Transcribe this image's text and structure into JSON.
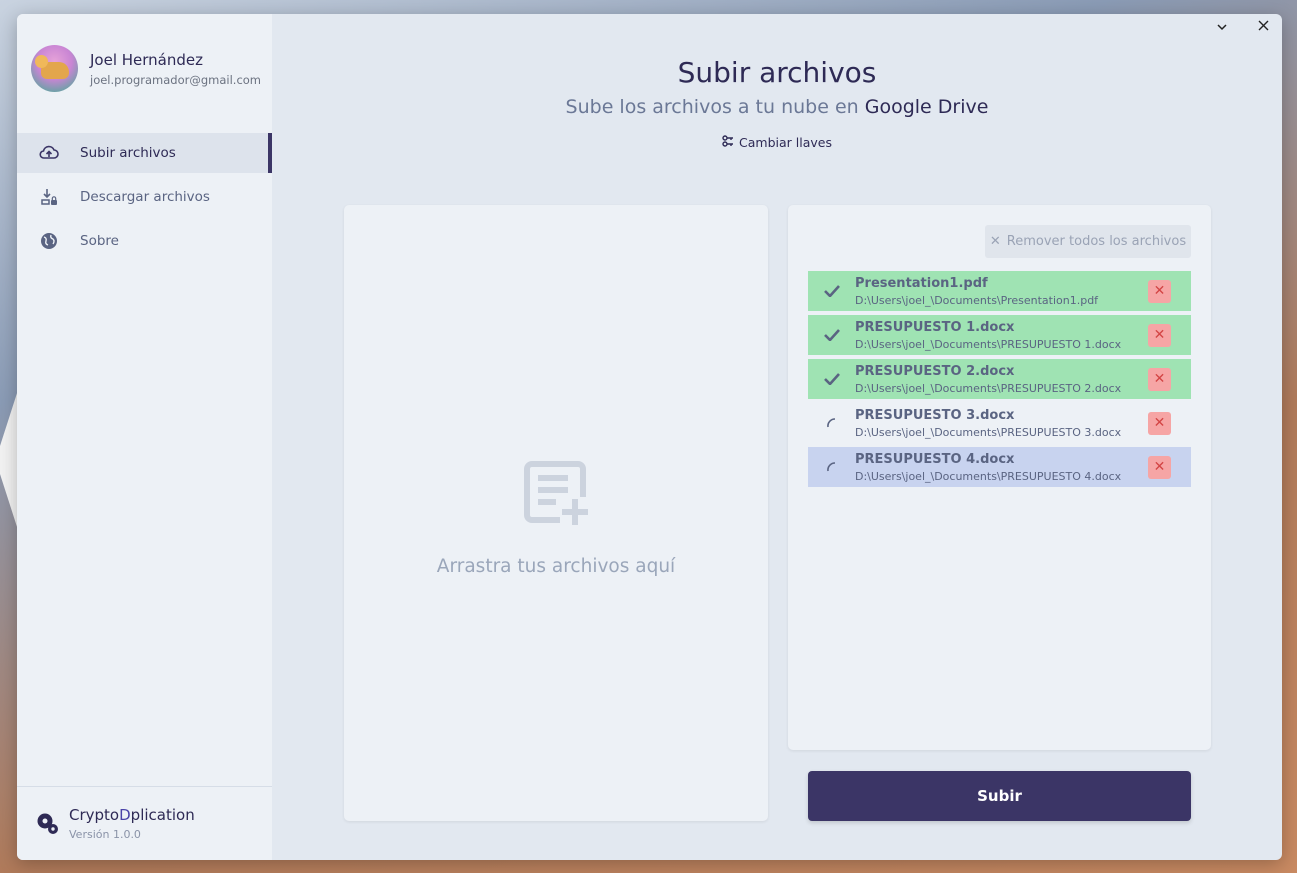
{
  "window": {
    "minimize_icon": "chevron-down-icon",
    "close_icon": "close-icon"
  },
  "profile": {
    "name": "Joel Hernández",
    "email": "joel.programador@gmail.com"
  },
  "sidebar": {
    "items": [
      {
        "label": "Subir archivos",
        "icon": "cloud-upload-icon",
        "active": true
      },
      {
        "label": "Descargar archivos",
        "icon": "download-lock-icon",
        "active": false
      },
      {
        "label": "Sobre",
        "icon": "globe-icon",
        "active": false
      }
    ]
  },
  "brand": {
    "name_part1": "Crypto",
    "name_part2": "D",
    "name_part3": "plication",
    "version": "Versión 1.0.0"
  },
  "main": {
    "title": "Subir archivos",
    "subtitle_prefix": "Sube los archivos a tu nube en ",
    "subtitle_brand": "Google Drive",
    "keys_button": "Cambiar llaves"
  },
  "dropzone": {
    "text": "Arrastra tus archivos aquí"
  },
  "files": {
    "remove_all_label": "Remover todos los archivos",
    "items": [
      {
        "name": "Presentation1.pdf",
        "path": "D:\\Users\\joel_\\Documents\\Presentation1.pdf",
        "status": "done"
      },
      {
        "name": "PRESUPUESTO 1.docx",
        "path": "D:\\Users\\joel_\\Documents\\PRESUPUESTO 1.docx",
        "status": "done"
      },
      {
        "name": "PRESUPUESTO 2.docx",
        "path": "D:\\Users\\joel_\\Documents\\PRESUPUESTO 2.docx",
        "status": "done"
      },
      {
        "name": "PRESUPUESTO 3.docx",
        "path": "D:\\Users\\joel_\\Documents\\PRESUPUESTO 3.docx",
        "status": "pending"
      },
      {
        "name": "PRESUPUESTO 4.docx",
        "path": "D:\\Users\\joel_\\Documents\\PRESUPUESTO 4.docx",
        "status": "selected"
      }
    ]
  },
  "actions": {
    "upload_label": "Subir"
  },
  "colors": {
    "primary": "#3b3566",
    "done": "#9fe3b3",
    "selected": "#c8d3ef",
    "remove": "#f6a5a5"
  }
}
